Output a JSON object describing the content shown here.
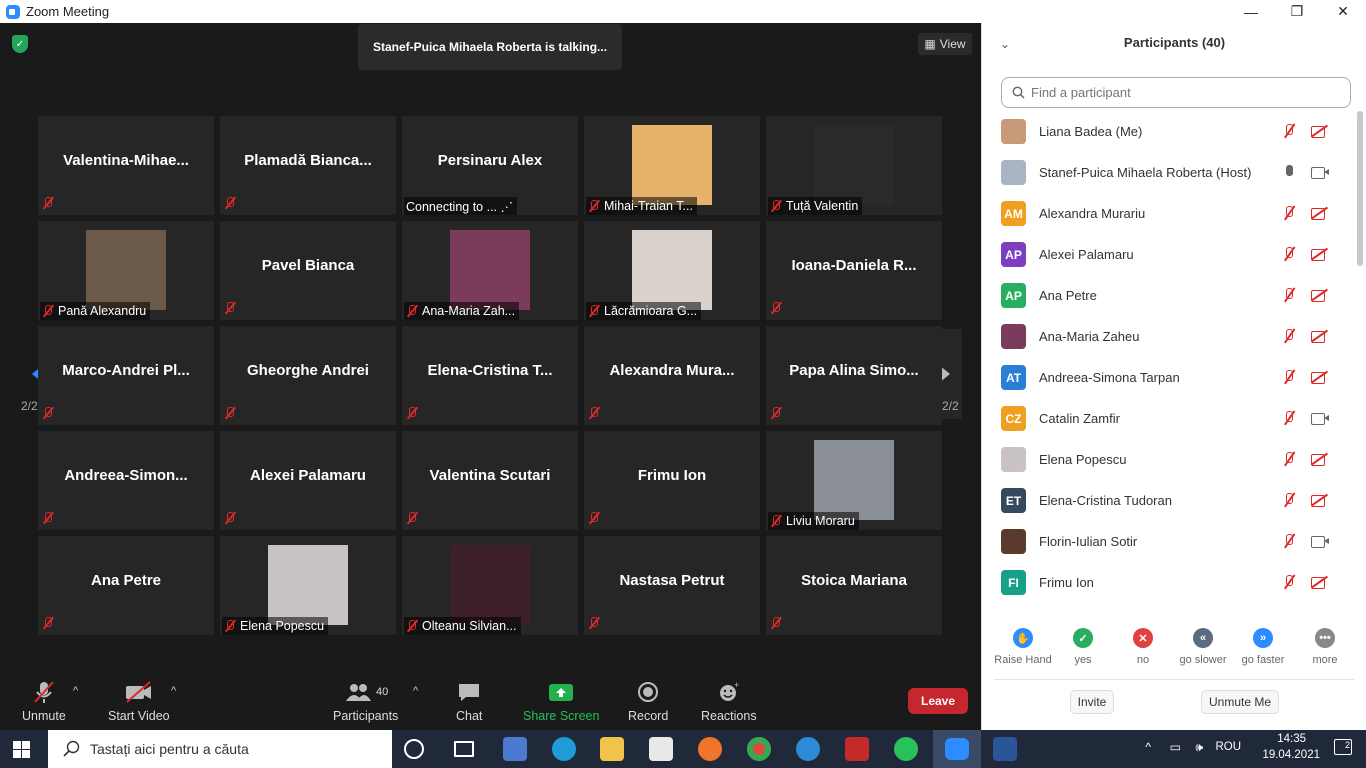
{
  "window": {
    "title": "Zoom Meeting",
    "controls": [
      "—",
      "❐",
      "✕"
    ]
  },
  "meeting": {
    "talking": "Stanef-Puica Mihaela Roberta is talking...",
    "view_label": "View",
    "page_left": "2/2",
    "page_right": "2/2",
    "tiles": [
      {
        "name": "Valentina-Mihae...",
        "type": "name"
      },
      {
        "name": "Plamadă  Bianca...",
        "type": "name"
      },
      {
        "name": "Persinaru Alex",
        "type": "name",
        "label": "Connecting to ... ⋰"
      },
      {
        "name": "",
        "type": "photo",
        "label": "Mihai-Traian T...",
        "color": "#e7b36a"
      },
      {
        "name": "",
        "type": "photo",
        "label": "Tuță Valentin",
        "color": "#2a2a2a"
      },
      {
        "name": "",
        "type": "photo",
        "label": "Pană Alexandru",
        "color": "#6b5a4a"
      },
      {
        "name": "Pavel Bianca",
        "type": "name"
      },
      {
        "name": "",
        "type": "photo",
        "label": "Ana-Maria Zah...",
        "color": "#7a3c5a"
      },
      {
        "name": "",
        "type": "photo",
        "label": "Lăcrămioara G...",
        "color": "#d9d2cc"
      },
      {
        "name": "Ioana-Daniela  R...",
        "type": "name"
      },
      {
        "name": "Marco-Andrei  Pl...",
        "type": "name"
      },
      {
        "name": "Gheorghe Andrei",
        "type": "name"
      },
      {
        "name": "Elena-Cristina  T...",
        "type": "name"
      },
      {
        "name": "Alexandra  Mura...",
        "type": "name"
      },
      {
        "name": "Papa Alina Simo...",
        "type": "name"
      },
      {
        "name": "Andreea-Simon...",
        "type": "name"
      },
      {
        "name": "Alexei Palamaru",
        "type": "name"
      },
      {
        "name": "Valentina Scutari",
        "type": "name"
      },
      {
        "name": "Frimu Ion",
        "type": "name"
      },
      {
        "name": "",
        "type": "photo",
        "label": "Liviu Moraru",
        "color": "#8a8f96"
      },
      {
        "name": "Ana Petre",
        "type": "name"
      },
      {
        "name": "",
        "type": "photo",
        "label": "Elena Popescu",
        "color": "#c9c2c6"
      },
      {
        "name": "",
        "type": "photo",
        "label": "Olteanu Silvian...",
        "color": "#3c1f2a"
      },
      {
        "name": "Nastasa Petrut",
        "type": "name"
      },
      {
        "name": "Stoica Mariana",
        "type": "name"
      }
    ]
  },
  "toolbar": {
    "unmute": "Unmute",
    "start_video": "Start Video",
    "participants": "Participants",
    "participants_count": "40",
    "chat": "Chat",
    "share_screen": "Share Screen",
    "record": "Record",
    "reactions": "Reactions",
    "leave": "Leave"
  },
  "panel": {
    "title": "Participants (40)",
    "search_placeholder": "Find a participant",
    "participants": [
      {
        "name": "Liana Badea (Me)",
        "initials": "",
        "color": "#c79a7a",
        "mic": "off",
        "cam": "off"
      },
      {
        "name": "Stanef-Puica Mihaela Roberta (Host)",
        "initials": "",
        "color": "#a9b4c2",
        "mic": "on",
        "cam": "on"
      },
      {
        "name": "Alexandra Murariu",
        "initials": "AM",
        "color": "#f0a020",
        "mic": "off",
        "cam": "off"
      },
      {
        "name": "Alexei Palamaru",
        "initials": "AP",
        "color": "#7c3fc2",
        "mic": "off",
        "cam": "off"
      },
      {
        "name": "Ana Petre",
        "initials": "AP",
        "color": "#27ae60",
        "mic": "off",
        "cam": "off"
      },
      {
        "name": "Ana-Maria Zaheu",
        "initials": "",
        "color": "#7a3c5a",
        "mic": "off",
        "cam": "off"
      },
      {
        "name": "Andreea-Simona Tarpan",
        "initials": "AT",
        "color": "#2a7fd4",
        "mic": "off",
        "cam": "off"
      },
      {
        "name": "Catalin Zamfir",
        "initials": "CZ",
        "color": "#f0a020",
        "mic": "off",
        "cam": "on"
      },
      {
        "name": "Elena Popescu",
        "initials": "",
        "color": "#c9c2c6",
        "mic": "off",
        "cam": "off"
      },
      {
        "name": "Elena-Cristina Tudoran",
        "initials": "ET",
        "color": "#34495e",
        "mic": "off",
        "cam": "off"
      },
      {
        "name": "Florin-Iulian Sotir",
        "initials": "",
        "color": "#5a3a2a",
        "mic": "off",
        "cam": "on"
      },
      {
        "name": "Frimu Ion",
        "initials": "FI",
        "color": "#16a085",
        "mic": "off",
        "cam": "off"
      }
    ],
    "feedback": [
      {
        "label": "Raise Hand",
        "symbol": "✋",
        "color": "#2d8cff"
      },
      {
        "label": "yes",
        "symbol": "✓",
        "color": "#27ae60"
      },
      {
        "label": "no",
        "symbol": "✕",
        "color": "#e04040"
      },
      {
        "label": "go slower",
        "symbol": "«",
        "color": "#5b6b80"
      },
      {
        "label": "go faster",
        "symbol": "»",
        "color": "#2d8cff"
      },
      {
        "label": "more",
        "symbol": "•••",
        "color": "#888888"
      }
    ],
    "invite": "Invite",
    "unmute_me": "Unmute Me"
  },
  "taskbar": {
    "search_placeholder": "Tastați aici pentru a căuta",
    "language": "ROU",
    "time": "14:35",
    "date": "19.04.2021",
    "notifications": "2"
  }
}
